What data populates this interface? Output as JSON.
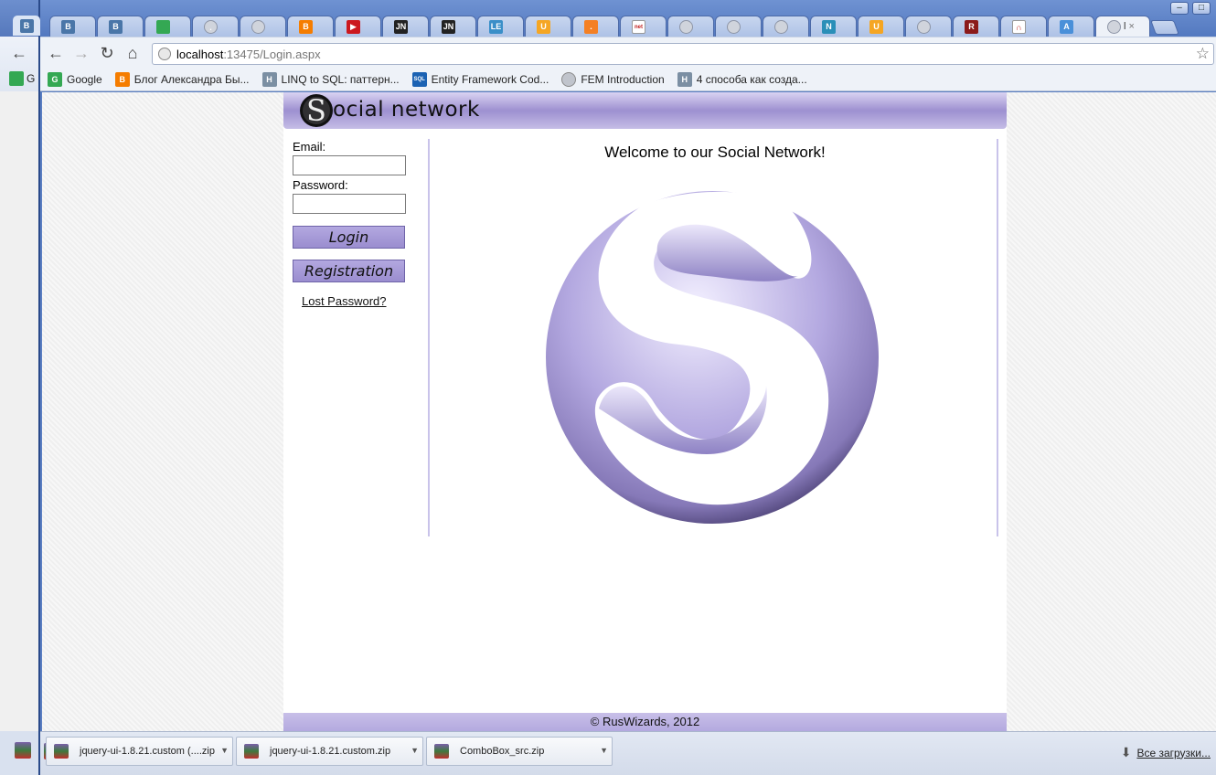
{
  "browser": {
    "url_host": "localhost",
    "url_rest": ":13475/Login.aspx",
    "tabs": [
      {
        "icon": "vk-icon",
        "label": "B",
        "color": "#4a76a8"
      },
      {
        "icon": "vk-icon",
        "label": "B",
        "color": "#4a76a8"
      },
      {
        "icon": "google-icon",
        "label": "",
        "color": "#34a853"
      },
      {
        "icon": "globe-icon",
        "label": ".",
        "color": ""
      },
      {
        "icon": "globe-icon",
        "label": "",
        "color": ""
      },
      {
        "icon": "blogger-icon",
        "label": "B",
        "color": "#f57d00"
      },
      {
        "icon": "youtube-icon",
        "label": "▶",
        "color": "#cc181e"
      },
      {
        "icon": "jn-icon",
        "label": "JN",
        "color": "#222222"
      },
      {
        "icon": "jn-icon",
        "label": "JN",
        "color": "#222222"
      },
      {
        "icon": "le-icon",
        "label": "LE",
        "color": "#3a8fc8"
      },
      {
        "icon": "u-icon",
        "label": "U",
        "color": "#f5a623"
      },
      {
        "icon": "stackoverflow-icon",
        "label": ".",
        "color": "#f48024"
      },
      {
        "icon": "net-icon",
        "label": "net",
        "color": "#ffffff"
      },
      {
        "icon": "globe-icon",
        "label": "",
        "color": ""
      },
      {
        "icon": "globe-icon",
        "label": "",
        "color": ""
      },
      {
        "icon": "globe-icon",
        "label": "",
        "color": ""
      },
      {
        "icon": "aspnet-icon",
        "label": "N",
        "color": "#2a8fb8"
      },
      {
        "icon": "u-icon",
        "label": "U",
        "color": "#f5a623"
      },
      {
        "icon": "globe-icon",
        "label": "",
        "color": ""
      },
      {
        "icon": "r-icon",
        "label": "R",
        "color": "#8b1a1a"
      },
      {
        "icon": "arch-icon",
        "label": "∩",
        "color": "#ffffff"
      },
      {
        "icon": "translate-icon",
        "label": "A",
        "color": "#4a90d9"
      }
    ],
    "active_tab": {
      "label": "l",
      "close": "×"
    },
    "bookmarks": [
      {
        "icon": "google-icon",
        "label": "Google",
        "color": "#34a853",
        "glyph": "G"
      },
      {
        "icon": "blogger-icon",
        "label": "Блог Александра Бы...",
        "color": "#f57d00",
        "glyph": "B"
      },
      {
        "icon": "habr-icon",
        "label": "LINQ to SQL: паттерн...",
        "color": "#7b8fa3",
        "glyph": "H"
      },
      {
        "icon": "sqlru-icon",
        "label": "Entity Framework Cod...",
        "color": "#1b62b3",
        "glyph": "SQL"
      },
      {
        "icon": "globe-icon",
        "label": "FEM Introduction",
        "color": "#c0c4cc",
        "glyph": ""
      },
      {
        "icon": "habr-icon",
        "label": "4 способа как созда...",
        "color": "#7b8fa3",
        "glyph": "H"
      }
    ],
    "bg_window_tab": "B",
    "bg_window_bookmark": "G"
  },
  "site": {
    "logo_text": "ocial network",
    "email_label": "Email:",
    "email_value": "",
    "password_label": "Password:",
    "password_value": "",
    "login_button": "Login",
    "registration_button": "Registration",
    "lost_password": "Lost Password?",
    "welcome": "Welcome to our Social Network!",
    "footer": "© RusWizards, 2012",
    "accent_color": "#9d90d0"
  },
  "downloads": {
    "items": [
      {
        "name": "jquery-ui-1.8.21.custom (....zip"
      },
      {
        "name": "jquery-ui-1.8.21.custom.zip"
      },
      {
        "name": "ComboBox_src.zip"
      }
    ],
    "all_label": "Все загрузки..."
  }
}
